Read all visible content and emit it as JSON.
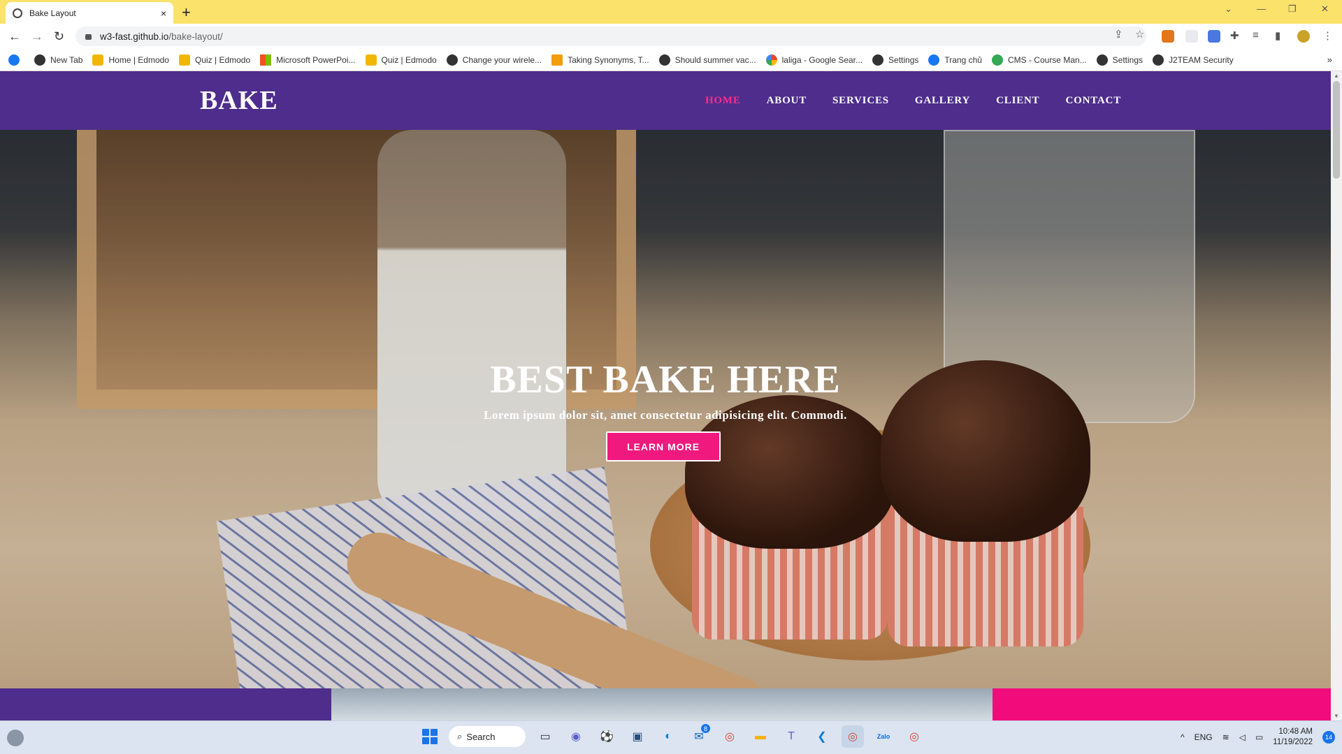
{
  "browser": {
    "tab_title": "Bake Layout",
    "tab_close": "×",
    "new_tab": "+",
    "url_host": "w3-fast.github.io",
    "url_path": "/bake-layout/",
    "window_controls": [
      "⌄",
      "—",
      "❐",
      "✕"
    ],
    "bookmarks": [
      {
        "label": "",
        "color": "#1877f2"
      },
      {
        "label": "New Tab",
        "color": "#333333"
      },
      {
        "label": "Home | Edmodo",
        "color": "#f2b705"
      },
      {
        "label": "Quiz | Edmodo",
        "color": "#f2b705"
      },
      {
        "label": "Microsoft PowerPoi...",
        "color": "#d24726"
      },
      {
        "label": "Quiz | Edmodo",
        "color": "#f2b705"
      },
      {
        "label": "Change your wirele...",
        "color": "#333333"
      },
      {
        "label": "Taking Synonyms, T...",
        "color": "#f29d0c"
      },
      {
        "label": "Should summer vac...",
        "color": "#333333"
      },
      {
        "label": "laliga - Google Sear...",
        "color": "#4285f4"
      },
      {
        "label": "Settings",
        "color": "#333333"
      },
      {
        "label": "Trang chủ",
        "color": "#1877f2"
      },
      {
        "label": "CMS - Course Man...",
        "color": "#34a853"
      },
      {
        "label": "Settings",
        "color": "#333333"
      },
      {
        "label": "J2TEAM Security",
        "color": "#333333"
      }
    ],
    "bookmarks_more": "»"
  },
  "site": {
    "brand": "BAKE",
    "menu": [
      "HOME",
      "ABOUT",
      "SERVICES",
      "GALLERY",
      "CLIENT",
      "CONTACT"
    ],
    "active_menu": "HOME",
    "hero_title": "BEST BAKE HERE",
    "hero_subtitle": "Lorem ipsum dolor sit, amet consectetur adipisicing elit. Commodi.",
    "hero_button": "LEARN MORE",
    "colors": {
      "nav_bg": "#4e2d8c",
      "accent": "#f0197d",
      "active_link": "#ff2d8a"
    }
  },
  "taskbar": {
    "search_label": "Search",
    "apps": [
      "file-explorer-icon",
      "teams-chat-icon",
      "soccer-icon",
      "codeblocks-icon",
      "edge-icon",
      "mail-icon",
      "chrome-icon",
      "folder-icon",
      "teams-icon",
      "vscode-icon",
      "chrome-icon",
      "zalo-icon",
      "chrome-icon"
    ],
    "mail_badge": "8",
    "language": "ENG",
    "time": "10:48 AM",
    "date": "11/19/2022",
    "notifications": "14"
  }
}
